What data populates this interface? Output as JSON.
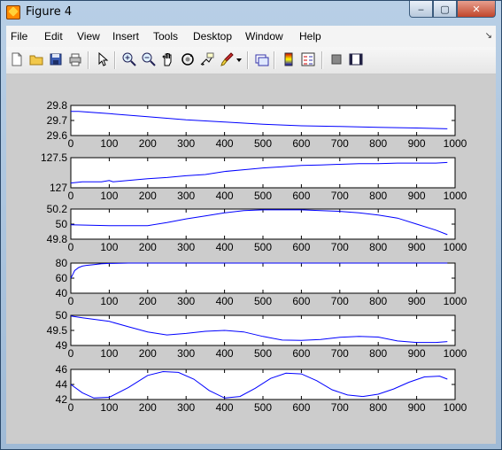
{
  "window": {
    "title": "Figure 4"
  },
  "window_buttons": {
    "minimize": "‒",
    "maximize": "▢",
    "close": "✕"
  },
  "menu": [
    "File",
    "Edit",
    "View",
    "Insert",
    "Tools",
    "Desktop",
    "Window",
    "Help"
  ],
  "menu_overflow": "↘",
  "toolbar": [
    "new-figure-icon",
    "open-file-icon",
    "save-icon",
    "print-icon",
    "edit-plot-icon",
    "zoom-in-icon",
    "zoom-out-icon",
    "pan-icon",
    "rotate-3d-icon",
    "data-cursor-icon",
    "brush-icon",
    "brush-dropdown-icon",
    "link-plot-icon",
    "insert-colorbar-icon",
    "insert-legend-icon",
    "hide-plot-tools-icon",
    "show-plot-tools-icon"
  ],
  "colors": {
    "line": "#0000ff",
    "axes_bg": "#ffffff",
    "figure_bg": "#cccccc"
  },
  "chart_data": [
    {
      "type": "line",
      "xlim": [
        0,
        1000
      ],
      "ylim": [
        29.6,
        29.8
      ],
      "xticks": [
        "0",
        "100",
        "200",
        "300",
        "400",
        "500",
        "600",
        "700",
        "800",
        "900",
        "1000"
      ],
      "yticks": [
        "29.6",
        "29.7",
        "29.8"
      ],
      "yticks_v": [
        29.6,
        29.7,
        29.8
      ],
      "x": [
        0,
        20,
        100,
        200,
        300,
        400,
        500,
        600,
        700,
        800,
        900,
        980
      ],
      "y": [
        29.76,
        29.76,
        29.745,
        29.725,
        29.705,
        29.69,
        29.675,
        29.665,
        29.66,
        29.655,
        29.65,
        29.645
      ]
    },
    {
      "type": "line",
      "xlim": [
        0,
        1000
      ],
      "ylim": [
        127,
        127.5
      ],
      "xticks": [
        "0",
        "100",
        "200",
        "300",
        "400",
        "500",
        "600",
        "700",
        "800",
        "900",
        "1000"
      ],
      "yticks": [
        "127",
        "127.5"
      ],
      "yticks_v": [
        127,
        127.5
      ],
      "x": [
        0,
        30,
        80,
        100,
        110,
        200,
        250,
        300,
        350,
        400,
        450,
        500,
        550,
        600,
        650,
        700,
        750,
        800,
        850,
        900,
        950,
        980
      ],
      "y": [
        127.08,
        127.1,
        127.1,
        127.12,
        127.1,
        127.15,
        127.17,
        127.2,
        127.22,
        127.27,
        127.3,
        127.33,
        127.35,
        127.37,
        127.38,
        127.39,
        127.4,
        127.4,
        127.41,
        127.41,
        127.41,
        127.42
      ]
    },
    {
      "type": "line",
      "xlim": [
        0,
        1000
      ],
      "ylim": [
        49.8,
        50.2
      ],
      "xticks": [
        "0",
        "100",
        "200",
        "300",
        "400",
        "500",
        "600",
        "700",
        "800",
        "900",
        "1000"
      ],
      "yticks": [
        "49.8",
        "50",
        "50.2"
      ],
      "yticks_v": [
        49.8,
        50.0,
        50.2
      ],
      "x": [
        0,
        100,
        200,
        250,
        300,
        350,
        400,
        450,
        500,
        550,
        600,
        650,
        700,
        750,
        800,
        850,
        900,
        950,
        980
      ],
      "y": [
        49.99,
        49.98,
        49.98,
        50.02,
        50.07,
        50.11,
        50.15,
        50.18,
        50.19,
        50.19,
        50.19,
        50.18,
        50.17,
        50.15,
        50.12,
        50.08,
        50.0,
        49.92,
        49.86
      ]
    },
    {
      "type": "line",
      "xlim": [
        0,
        1000
      ],
      "ylim": [
        40,
        80
      ],
      "xticks": [
        "0",
        "100",
        "200",
        "300",
        "400",
        "500",
        "600",
        "700",
        "800",
        "900",
        "1000"
      ],
      "yticks": [
        "40",
        "60",
        "80"
      ],
      "yticks_v": [
        40,
        60,
        80
      ],
      "x": [
        0,
        5,
        10,
        20,
        30,
        40,
        60,
        80,
        100,
        150,
        200,
        300,
        400,
        500,
        600,
        700,
        800,
        900,
        980
      ],
      "y": [
        60,
        65,
        70,
        74,
        76,
        77,
        78,
        79,
        79.5,
        80,
        80,
        80,
        80,
        80,
        80,
        80,
        80,
        80,
        80
      ]
    },
    {
      "type": "line",
      "xlim": [
        0,
        1000
      ],
      "ylim": [
        49,
        50
      ],
      "xticks": [
        "0",
        "100",
        "200",
        "300",
        "400",
        "500",
        "600",
        "700",
        "800",
        "900",
        "1000"
      ],
      "yticks": [
        "49",
        "49.5",
        "50"
      ],
      "yticks_v": [
        49,
        49.5,
        50
      ],
      "x": [
        0,
        30,
        100,
        150,
        200,
        250,
        300,
        350,
        400,
        450,
        500,
        550,
        600,
        650,
        700,
        750,
        800,
        850,
        900,
        950,
        980
      ],
      "y": [
        49.98,
        49.92,
        49.8,
        49.62,
        49.45,
        49.35,
        49.4,
        49.47,
        49.5,
        49.45,
        49.3,
        49.18,
        49.17,
        49.2,
        49.27,
        49.3,
        49.28,
        49.15,
        49.1,
        49.1,
        49.13
      ]
    },
    {
      "type": "line",
      "xlim": [
        0,
        1000
      ],
      "ylim": [
        42,
        46
      ],
      "xticks": [
        "0",
        "100",
        "200",
        "300",
        "400",
        "500",
        "600",
        "700",
        "800",
        "900",
        "1000"
      ],
      "yticks": [
        "42",
        "44",
        "46"
      ],
      "yticks_v": [
        42,
        44,
        46
      ],
      "x": [
        0,
        30,
        60,
        100,
        150,
        200,
        240,
        280,
        320,
        360,
        400,
        440,
        480,
        520,
        560,
        600,
        640,
        680,
        720,
        760,
        800,
        840,
        880,
        920,
        960,
        980
      ],
      "y": [
        44,
        42.9,
        42.2,
        42.3,
        43.6,
        45.2,
        45.7,
        45.6,
        44.7,
        43.2,
        42.2,
        42.4,
        43.5,
        44.8,
        45.5,
        45.4,
        44.5,
        43.3,
        42.6,
        42.4,
        42.7,
        43.4,
        44.3,
        45.0,
        45.1,
        44.7
      ]
    }
  ]
}
